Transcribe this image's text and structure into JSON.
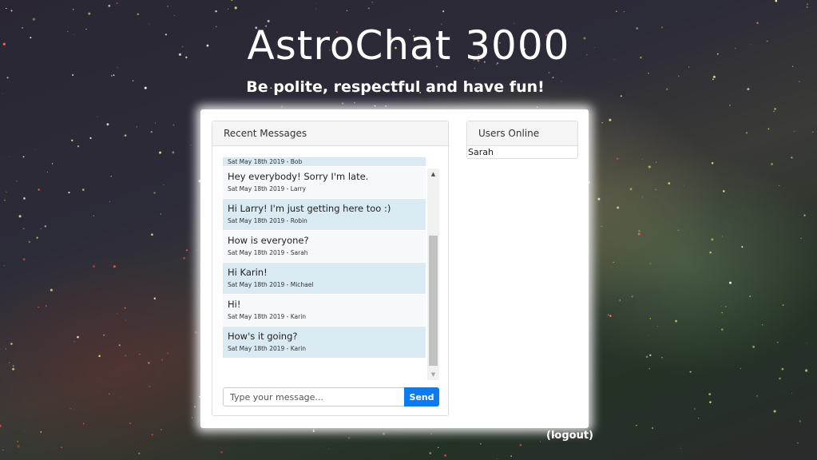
{
  "header": {
    "title": "AstroChat 3000",
    "subtitle": "Be polite, respectful and have fun!"
  },
  "messages_panel": {
    "heading": "Recent Messages",
    "messages": [
      {
        "text": "",
        "meta": "Sat May 18th 2019 - Bob",
        "style": "blue"
      },
      {
        "text": "Hey everybody! Sorry I'm late.",
        "meta": "Sat May 18th 2019 - Larry",
        "style": "light"
      },
      {
        "text": "Hi Larry! I'm just getting here too :)",
        "meta": "Sat May 18th 2019 - Robin",
        "style": "blue"
      },
      {
        "text": "How is everyone?",
        "meta": "Sat May 18th 2019 - Sarah",
        "style": "light"
      },
      {
        "text": "Hi Karin!",
        "meta": "Sat May 18th 2019 - Michael",
        "style": "blue"
      },
      {
        "text": "Hi!",
        "meta": "Sat May 18th 2019 - Karin",
        "style": "light"
      },
      {
        "text": "How's it going?",
        "meta": "Sat May 18th 2019 - Karin",
        "style": "blue"
      }
    ],
    "scroll_up_icon": "triangle-up",
    "scroll_down_icon": "triangle-down",
    "input_placeholder": "Type your message...",
    "input_value": "",
    "send_label": "Send"
  },
  "users_panel": {
    "heading": "Users Online",
    "users": [
      "Sarah"
    ]
  },
  "footer": {
    "logout_label": "(logout)"
  },
  "colors": {
    "send_button": "#0a7bf2",
    "message_blue": "#d9eaf2",
    "message_light": "#f7f8fc"
  }
}
